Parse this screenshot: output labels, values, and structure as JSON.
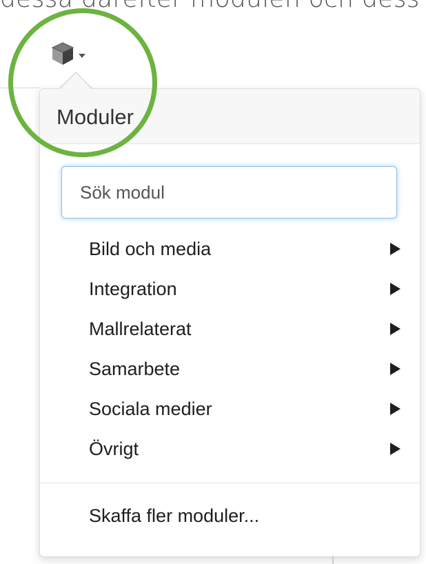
{
  "top_text": "dessa därefter modulen och dess",
  "toolbar": {
    "icon": "cube-icon",
    "caret_icon": "caret-down-icon"
  },
  "dropdown": {
    "title": "Moduler",
    "search": {
      "placeholder": "Sök modul",
      "value": ""
    },
    "categories": [
      {
        "label": "Bild och media",
        "icon": "submenu-arrow-icon"
      },
      {
        "label": "Integration",
        "icon": "submenu-arrow-icon"
      },
      {
        "label": "Mallrelaterat",
        "icon": "submenu-arrow-icon"
      },
      {
        "label": "Samarbete",
        "icon": "submenu-arrow-icon"
      },
      {
        "label": "Sociala medier",
        "icon": "submenu-arrow-icon"
      },
      {
        "label": "Övrigt",
        "icon": "submenu-arrow-icon"
      }
    ],
    "more_link": "Skaffa fler moduler..."
  },
  "colors": {
    "highlight_circle": "#6cb33f",
    "search_focus": "#66afe9",
    "header_bg": "#f7f7f7"
  }
}
